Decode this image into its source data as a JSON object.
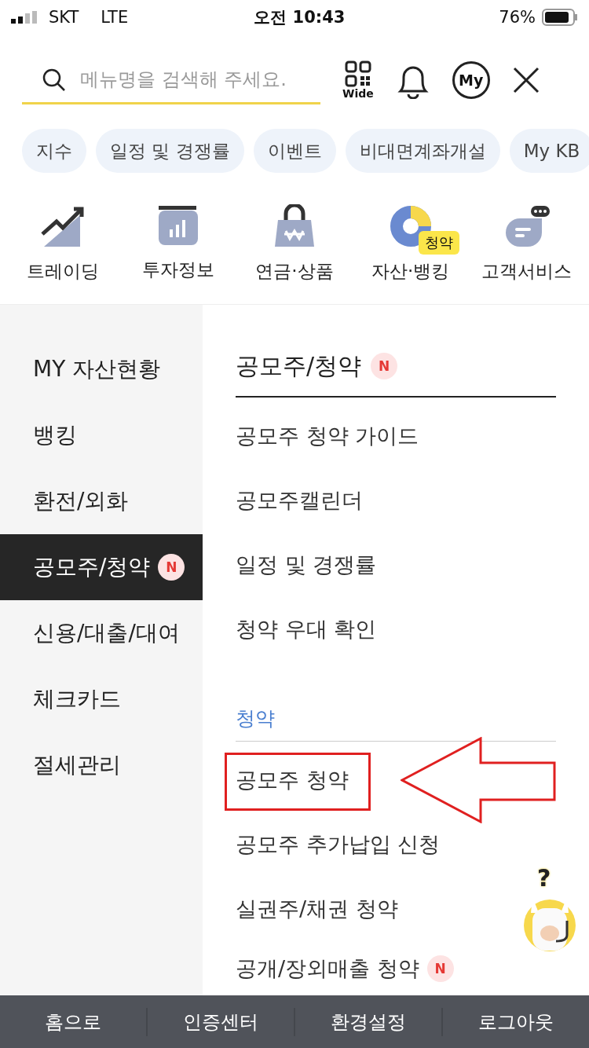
{
  "status_bar": {
    "carrier": "SKT",
    "network": "LTE",
    "time": "오전 10:43",
    "battery": "76%"
  },
  "search": {
    "placeholder": "메뉴명을 검색해 주세요.",
    "qr_label": "Wide",
    "my_label": "My"
  },
  "chips": [
    "지수",
    "일정 및 경쟁률",
    "이벤트",
    "비대면계좌개설",
    "My KB"
  ],
  "categories": [
    {
      "kind": "trading",
      "label": "트레이딩"
    },
    {
      "kind": "info",
      "label": "투자정보"
    },
    {
      "kind": "pension",
      "label": "연금·상품"
    },
    {
      "kind": "asset",
      "label": "자산·뱅킹",
      "badge": "청약"
    },
    {
      "kind": "service",
      "label": "고객서비스"
    }
  ],
  "sidebar": {
    "items": [
      {
        "label": "MY 자산현황",
        "selected": false
      },
      {
        "label": "뱅킹",
        "selected": false
      },
      {
        "label": "환전/외화",
        "selected": false
      },
      {
        "label": "공모주/청약",
        "selected": true,
        "badge": "N"
      },
      {
        "label": "신용/대출/대여",
        "selected": false
      },
      {
        "label": "체크카드",
        "selected": false
      },
      {
        "label": "절세관리",
        "selected": false
      }
    ]
  },
  "content": {
    "title": "공모주/청약",
    "title_badge": "N",
    "items": [
      {
        "label": "공모주 청약 가이드"
      },
      {
        "label": "공모주캘린더"
      },
      {
        "label": "일정 및 경쟁률"
      },
      {
        "label": "청약 우대 확인"
      }
    ],
    "section": "청약",
    "section_items": [
      {
        "label": "공모주 청약",
        "highlighted": true
      },
      {
        "label": "공모주 추가납입 신청",
        "highlighted": false
      },
      {
        "label": "실권주/채권 청약",
        "highlighted": false
      },
      {
        "label": "공개/장외매출 청약",
        "highlighted": false,
        "badge": "N"
      }
    ]
  },
  "help_button": {
    "mark": "?"
  },
  "bottom_bar": [
    "홈으로",
    "인증센터",
    "환경설정",
    "로그아웃"
  ]
}
